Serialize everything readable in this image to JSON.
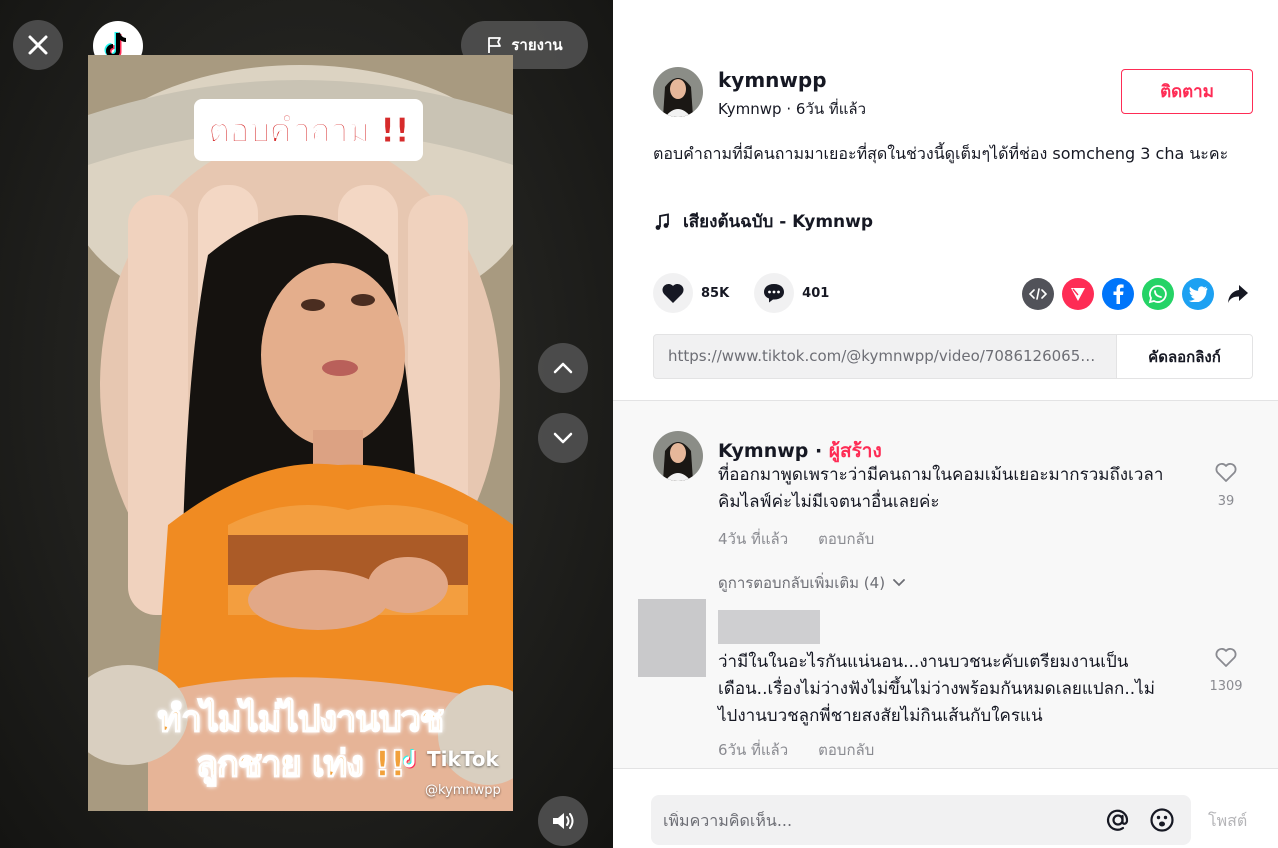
{
  "video": {
    "report_label": "รายงาน",
    "caption_top": "ตอบคำถาม !!",
    "caption_bottom_1": "ทำไมไม่ไปงานบวช",
    "caption_bottom_2": "ลูกชาย เท่ง !!",
    "watermark_brand": "TikTok",
    "watermark_handle": "@kymnwpp"
  },
  "post": {
    "username": "kymnwpp",
    "nickname": "Kymnwp",
    "posted": "6วัน ที่แล้ว",
    "follow_label": "ติดตาม",
    "description": "ตอบคำถามที่มีคนถามมาเยอะที่สุดในช่วงนี้ดูเต็มๆได้ที่ช่อง somcheng 3 cha นะคะ",
    "music": "เสียงต้นฉบับ - Kymnwp",
    "likes": "85K",
    "comments": "401",
    "link": "https://www.tiktok.com/@kymnwpp/video/70861260650...",
    "copy_label": "คัดลอกลิงก์"
  },
  "share_icons": [
    {
      "name": "embed",
      "color": "#515259"
    },
    {
      "name": "send",
      "color": "#fe2c55"
    },
    {
      "name": "facebook",
      "color": "#0075fa"
    },
    {
      "name": "whatsapp",
      "color": "#25d366"
    },
    {
      "name": "twitter",
      "color": "#1da1f2"
    },
    {
      "name": "share-arrow",
      "color": "#161823"
    }
  ],
  "comments": [
    {
      "author": "Kymnwp",
      "creator_badge": "ผู้สร้าง",
      "text": "ที่ออกมาพูดเพราะว่ามีคนถามในคอมเม้นเยอะมากรวมถึงเวลาคิมไลฟ์ค่ะไม่มีเจตนาอื่นเลยค่ะ",
      "time": "4วัน ที่แล้ว",
      "reply_label": "ตอบกลับ",
      "likes": "39"
    },
    {
      "author": "",
      "text": "ว่ามีในในอะไรกันแน่นอน...งานบวชนะคับเตรียมงานเป็นเดือน..เรื่องไม่ว่างฟังไม่ขึ้นไม่ว่างพร้อมกันหมดเลยแปลก..ไม่ไปงานบวชลูกพี่ชายสงสัยไม่กินเส้นกับใครแน่",
      "time": "6วัน ที่แล้ว",
      "reply_label": "ตอบกลับ",
      "likes": "1309"
    }
  ],
  "more_replies": "ดูการตอบกลับเพิ่มเติม (4)",
  "input": {
    "placeholder": "เพิ่มความคิดเห็น...",
    "post_label": "โพสต์"
  },
  "colors": {
    "accent": "#fe2c55",
    "text": "#161823",
    "muted": "#8a8b91"
  }
}
